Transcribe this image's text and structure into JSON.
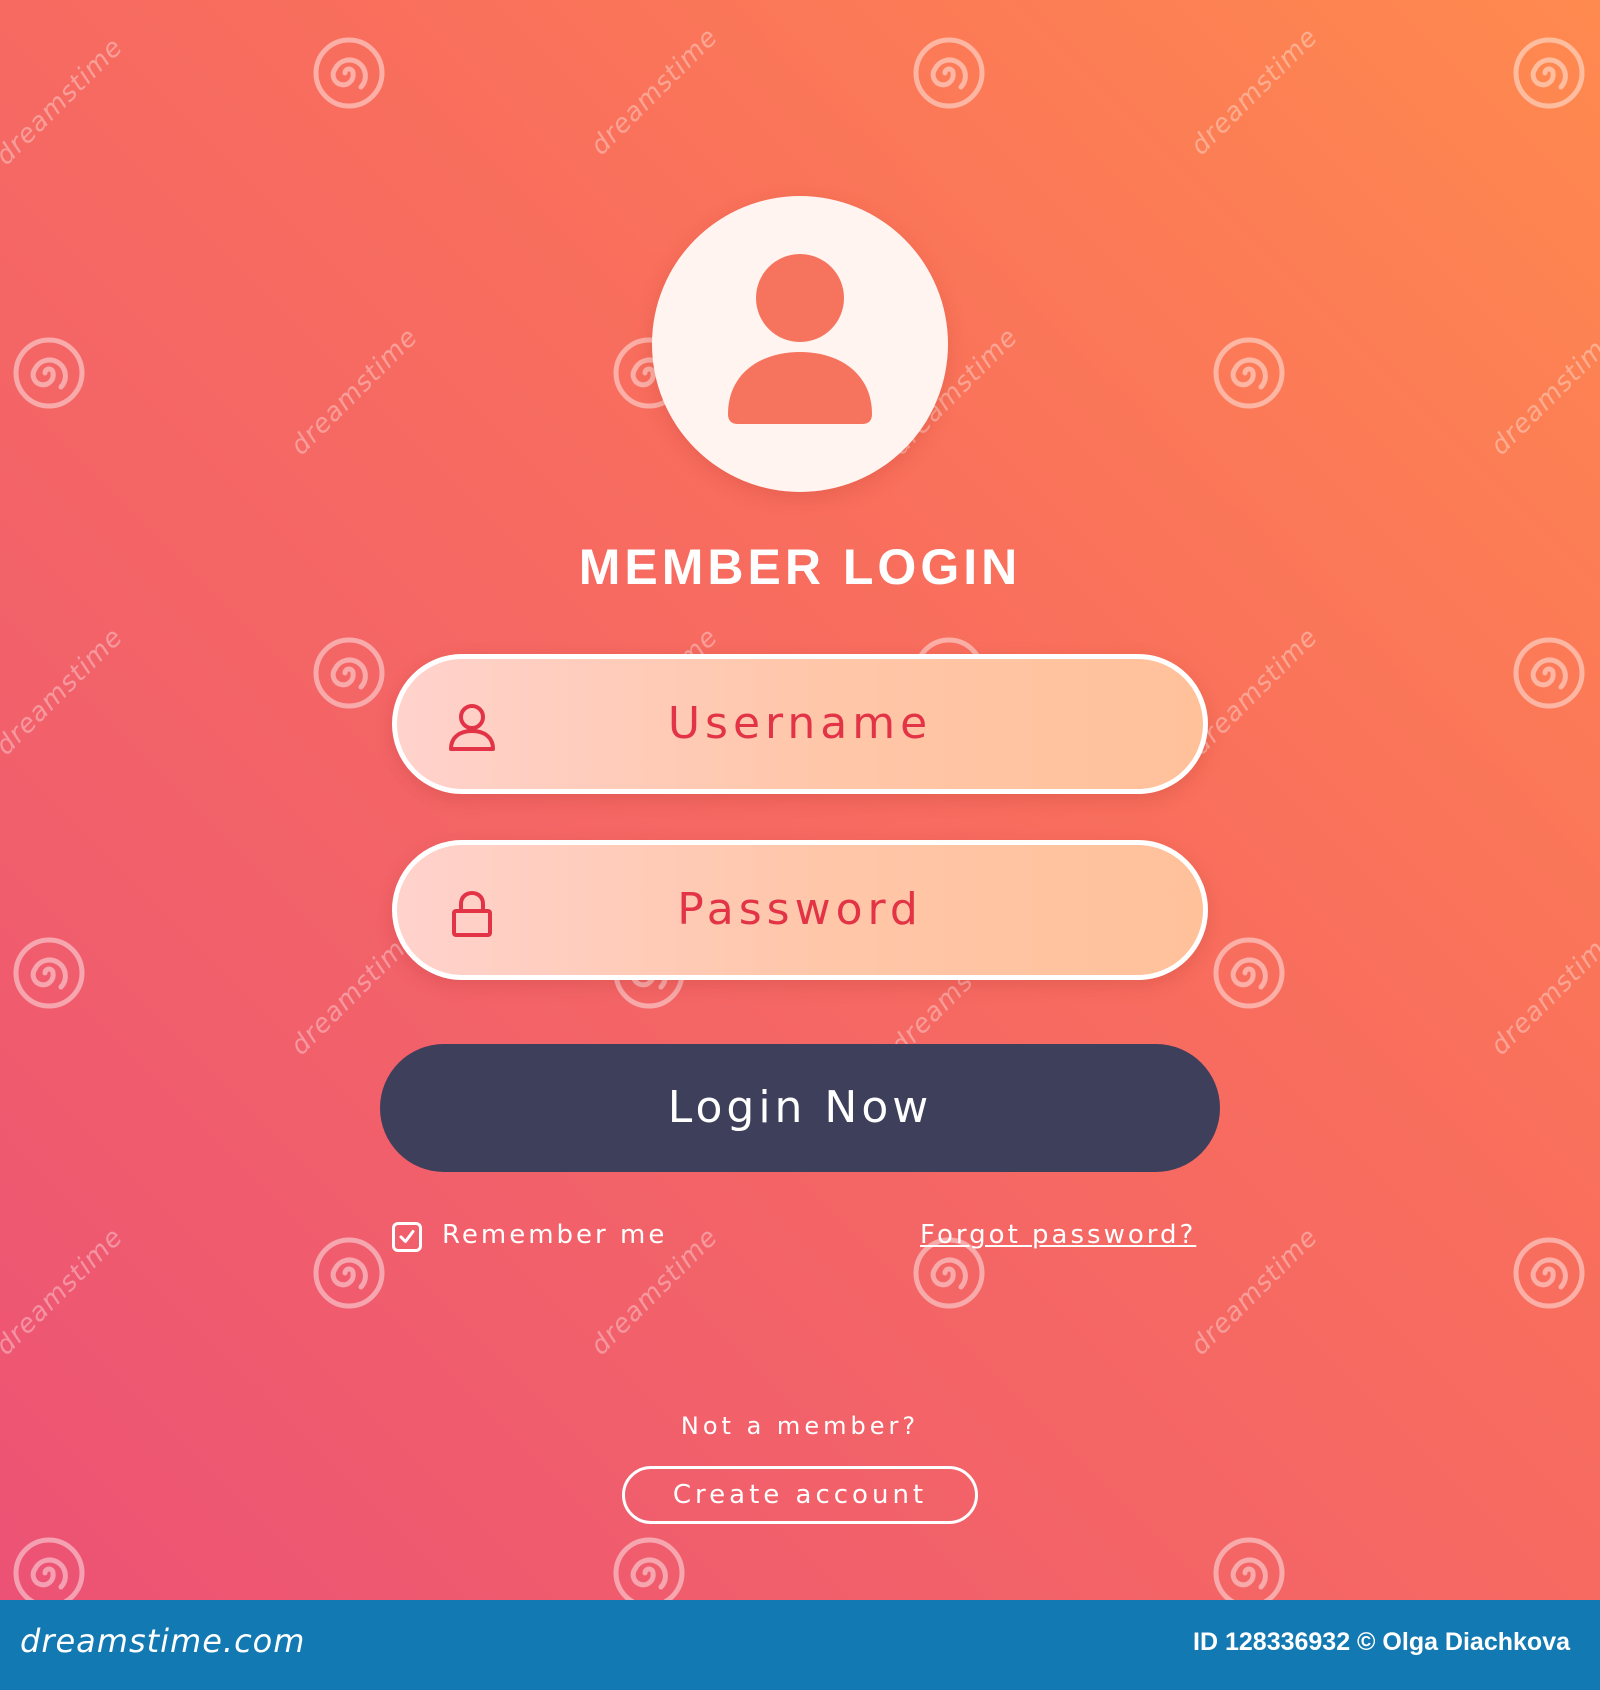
{
  "login": {
    "title": "MEMBER LOGIN",
    "username_placeholder": "Username",
    "password_placeholder": "Password",
    "login_button": "Login Now",
    "remember_label": "Remember me",
    "remember_checked": true,
    "forgot_link": "Forgot password?",
    "not_member_text": "Not a member?",
    "create_account_button": "Create account"
  },
  "icons": {
    "avatar": "user-avatar-icon",
    "username": "user-outline-icon",
    "password": "lock-icon",
    "checkbox": "checkmark-icon"
  },
  "watermark": {
    "text": "dreamstime"
  },
  "footer": {
    "logo_text": "dreamstime.com",
    "credit": "ID 128336932 © Olga Diachkova"
  },
  "colors": {
    "gradient_start": "#ff8a4f",
    "gradient_end": "#ec5275",
    "accent_red": "#e23446",
    "button_dark": "#3e3f5b",
    "footer_blue": "#1279b3"
  }
}
